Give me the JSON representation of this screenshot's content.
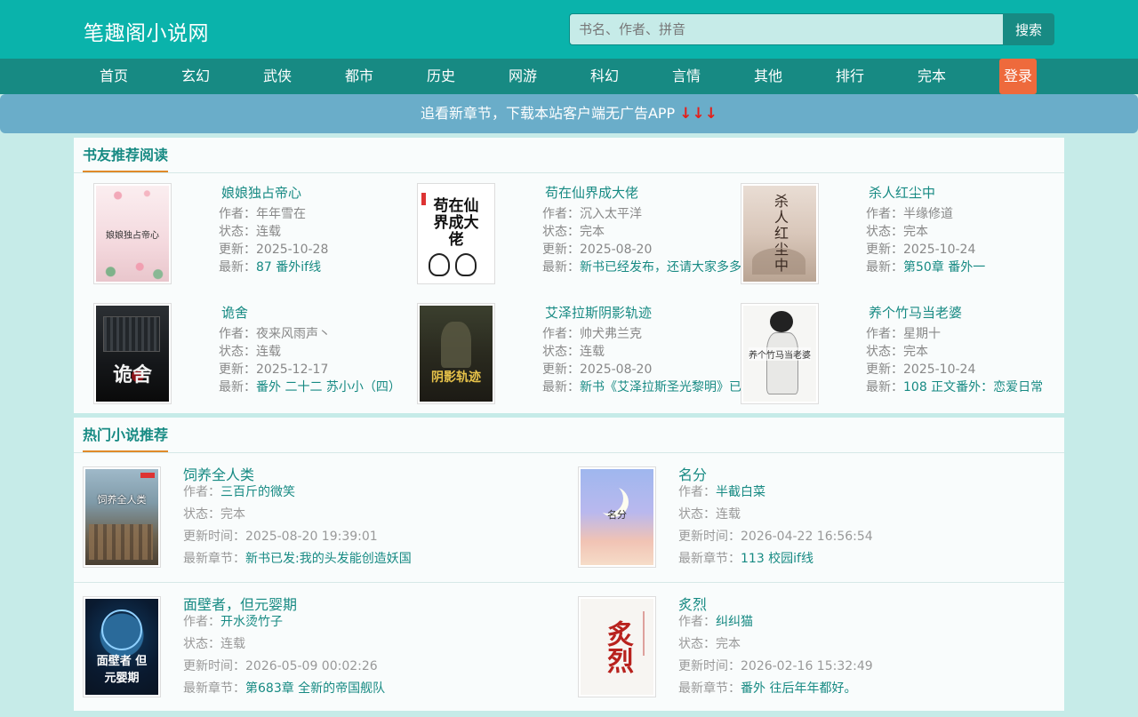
{
  "site": {
    "title": "笔趣阁小说网"
  },
  "search": {
    "placeholder": "书名、作者、拼音",
    "button": "搜索"
  },
  "nav": {
    "items": [
      "首页",
      "玄幻",
      "武侠",
      "都市",
      "历史",
      "网游",
      "科幻",
      "言情",
      "其他",
      "排行",
      "完本"
    ],
    "login": "登录"
  },
  "banner": {
    "text": "追看新章节，下载本站客户端无广告APP",
    "arrows": "↓↓↓"
  },
  "recommend": {
    "heading": "书友推荐阅读",
    "labels": {
      "author": "作者：",
      "status": "状态：",
      "updated": "更新：",
      "latest": "最新："
    },
    "books": [
      {
        "title": "娘娘独占帝心",
        "author": "年年雪在",
        "status": "连载",
        "updated": "2025-10-28",
        "latest": "87 番外if线",
        "cover_text": "娘娘独占帝心"
      },
      {
        "title": "苟在仙界成大佬",
        "author": "沉入太平洋",
        "status": "完本",
        "updated": "2025-08-20",
        "latest": "新书已经发布，还请大家多多",
        "cover_text": "苟在仙界成大佬"
      },
      {
        "title": "杀人红尘中",
        "author": "半缘修道",
        "status": "完本",
        "updated": "2025-10-24",
        "latest": "第50章 番外一",
        "cover_text": "杀人红尘中"
      },
      {
        "title": "诡舍",
        "author": "夜来风雨声丶",
        "status": "连载",
        "updated": "2025-12-17",
        "latest": "番外 二十二 苏小小（四）",
        "cover_text": "诡舍"
      },
      {
        "title": "艾泽拉斯阴影轨迹",
        "author": "帅犬弗兰克",
        "status": "连载",
        "updated": "2025-08-20",
        "latest": "新书《艾泽拉斯圣光黎明》已",
        "cover_text": "阴影轨迹"
      },
      {
        "title": "养个竹马当老婆",
        "author": "星期十",
        "status": "完本",
        "updated": "2025-10-24",
        "latest": "108 正文番外：恋爱日常",
        "cover_text": "养个竹马当老婆"
      }
    ]
  },
  "hot": {
    "heading": "热门小说推荐",
    "labels": {
      "author": "作者：",
      "status": "状态：",
      "updated": "更新时间：",
      "latest": "最新章节："
    },
    "books": [
      {
        "title": "饲养全人类",
        "author": "三百斤的微笑",
        "status": "完本",
        "updated": "2025-08-20 19:39:01",
        "latest": "新书已发:我的头发能创造妖国",
        "cover_text": "饲养全人类"
      },
      {
        "title": "名分",
        "author": "半截白菜",
        "status": "连载",
        "updated": "2026-04-22 16:56:54",
        "latest": "113 校园if线",
        "cover_text": "名分"
      },
      {
        "title": "面壁者，但元婴期",
        "author": "开水烫竹子",
        "status": "连载",
        "updated": "2026-05-09 00:02:26",
        "latest": "第683章 全新的帝国舰队",
        "cover_text": "面壁者 但元婴期"
      },
      {
        "title": "炙烈",
        "author": "纠纠猫",
        "status": "完本",
        "updated": "2026-02-16 15:32:49",
        "latest": "番外 往后年年都好。",
        "cover_text": "炙烈"
      }
    ]
  }
}
